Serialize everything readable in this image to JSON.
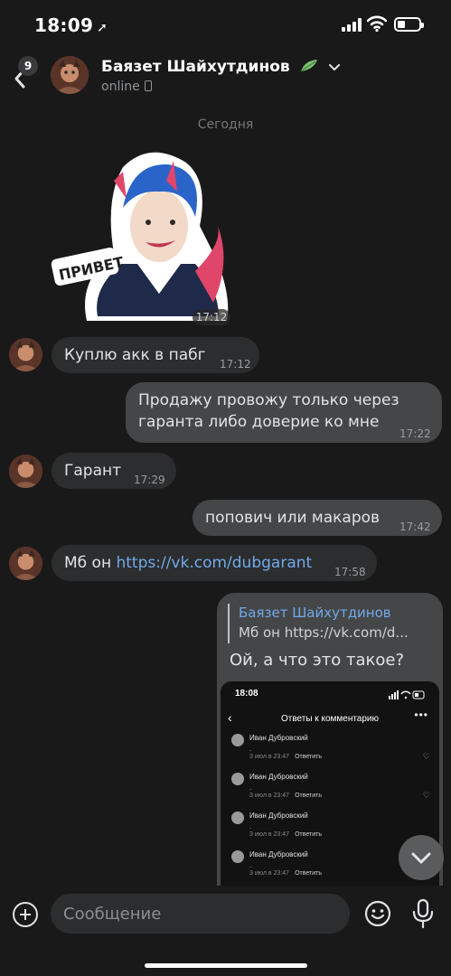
{
  "status_bar": {
    "time": "18:09",
    "location_icon": "location-arrow-icon",
    "signal_icon": "signal-icon",
    "wifi_icon": "wifi-icon",
    "battery_icon": "battery-icon"
  },
  "header": {
    "back_badge": "9",
    "name": "Баязет Шайхутдинов",
    "status": "online"
  },
  "date_separator": "Сегодня",
  "sticker": {
    "caption": "ПРИВЕТ",
    "time": "17:12"
  },
  "messages": [
    {
      "dir": "in",
      "text": "Куплю акк в пабг",
      "time": "17:12"
    },
    {
      "dir": "out",
      "lines": [
        "Продажу провожу только через",
        "гаранта либо доверие ко мне"
      ],
      "time": "17:22"
    },
    {
      "dir": "in",
      "text": "Гарант",
      "time": "17:29"
    },
    {
      "dir": "out",
      "text": "попович или макаров",
      "time": "17:42"
    },
    {
      "dir": "in",
      "text_prefix": "Мб он ",
      "link": "https://vk.com/dubgarant",
      "time": "17:58"
    }
  ],
  "reply": {
    "quote_author": "Баязет Шайхутдинов",
    "quote_text": "Мб он https://vk.com/d...",
    "text": "Ой, а что это такое?"
  },
  "screenshot": {
    "time": "18:08",
    "title": "Ответы к комментарию",
    "comments": [
      {
        "name": "Иван Дубровский",
        "body": ".",
        "date": "3 июл в 23:47",
        "reply": "Ответить"
      },
      {
        "name": "Иван Дубровский",
        "body": ".",
        "date": "3 июл в 23:47",
        "reply": "Ответить"
      },
      {
        "name": "Иван Дубровский",
        "body": ".",
        "date": "3 июл в 23:47",
        "reply": "Ответить"
      },
      {
        "name": "Иван Дубровский",
        "body": ".",
        "date": "3 июл в 23:47",
        "reply": "Ответить"
      }
    ]
  },
  "composer": {
    "placeholder": "Сообщение"
  },
  "colors": {
    "background": "#191919",
    "incoming": "#2c2d2e",
    "outgoing": "#454647",
    "link": "#71aaeb"
  }
}
